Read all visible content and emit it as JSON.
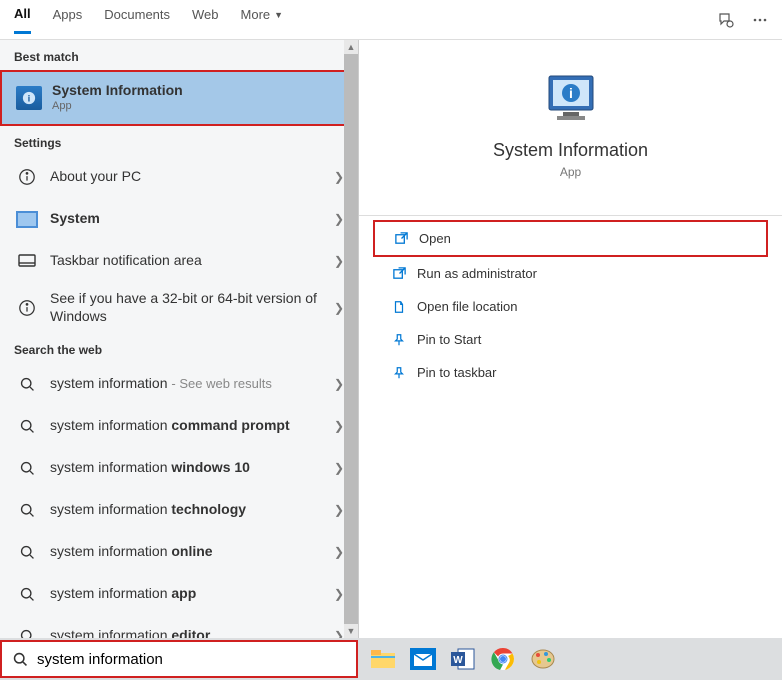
{
  "tabs": {
    "all": "All",
    "apps": "Apps",
    "documents": "Documents",
    "web": "Web",
    "more": "More"
  },
  "sections": {
    "best_match": "Best match",
    "settings": "Settings",
    "search_web": "Search the web"
  },
  "best_match": {
    "title": "System Information",
    "sub": "App"
  },
  "settings_items": [
    {
      "label": "About your PC"
    },
    {
      "label": "System",
      "bold": true
    },
    {
      "label": "Taskbar notification area"
    },
    {
      "label": "See if you have a 32-bit or 64-bit version of Windows"
    }
  ],
  "web_items": [
    {
      "prefix": "system information",
      "suffix": "",
      "tail": "See web results"
    },
    {
      "prefix": "system information ",
      "suffix": "command prompt",
      "tail": ""
    },
    {
      "prefix": "system information ",
      "suffix": "windows 10",
      "tail": ""
    },
    {
      "prefix": "system information ",
      "suffix": "technology",
      "tail": ""
    },
    {
      "prefix": "system information ",
      "suffix": "online",
      "tail": ""
    },
    {
      "prefix": "system information ",
      "suffix": "app",
      "tail": ""
    },
    {
      "prefix": "system information ",
      "suffix": "editor",
      "tail": ""
    }
  ],
  "preview": {
    "title": "System Information",
    "sub": "App"
  },
  "actions": {
    "open": "Open",
    "run_admin": "Run as administrator",
    "open_location": "Open file location",
    "pin_start": "Pin to Start",
    "pin_taskbar": "Pin to taskbar"
  },
  "search": {
    "value": "system information"
  }
}
